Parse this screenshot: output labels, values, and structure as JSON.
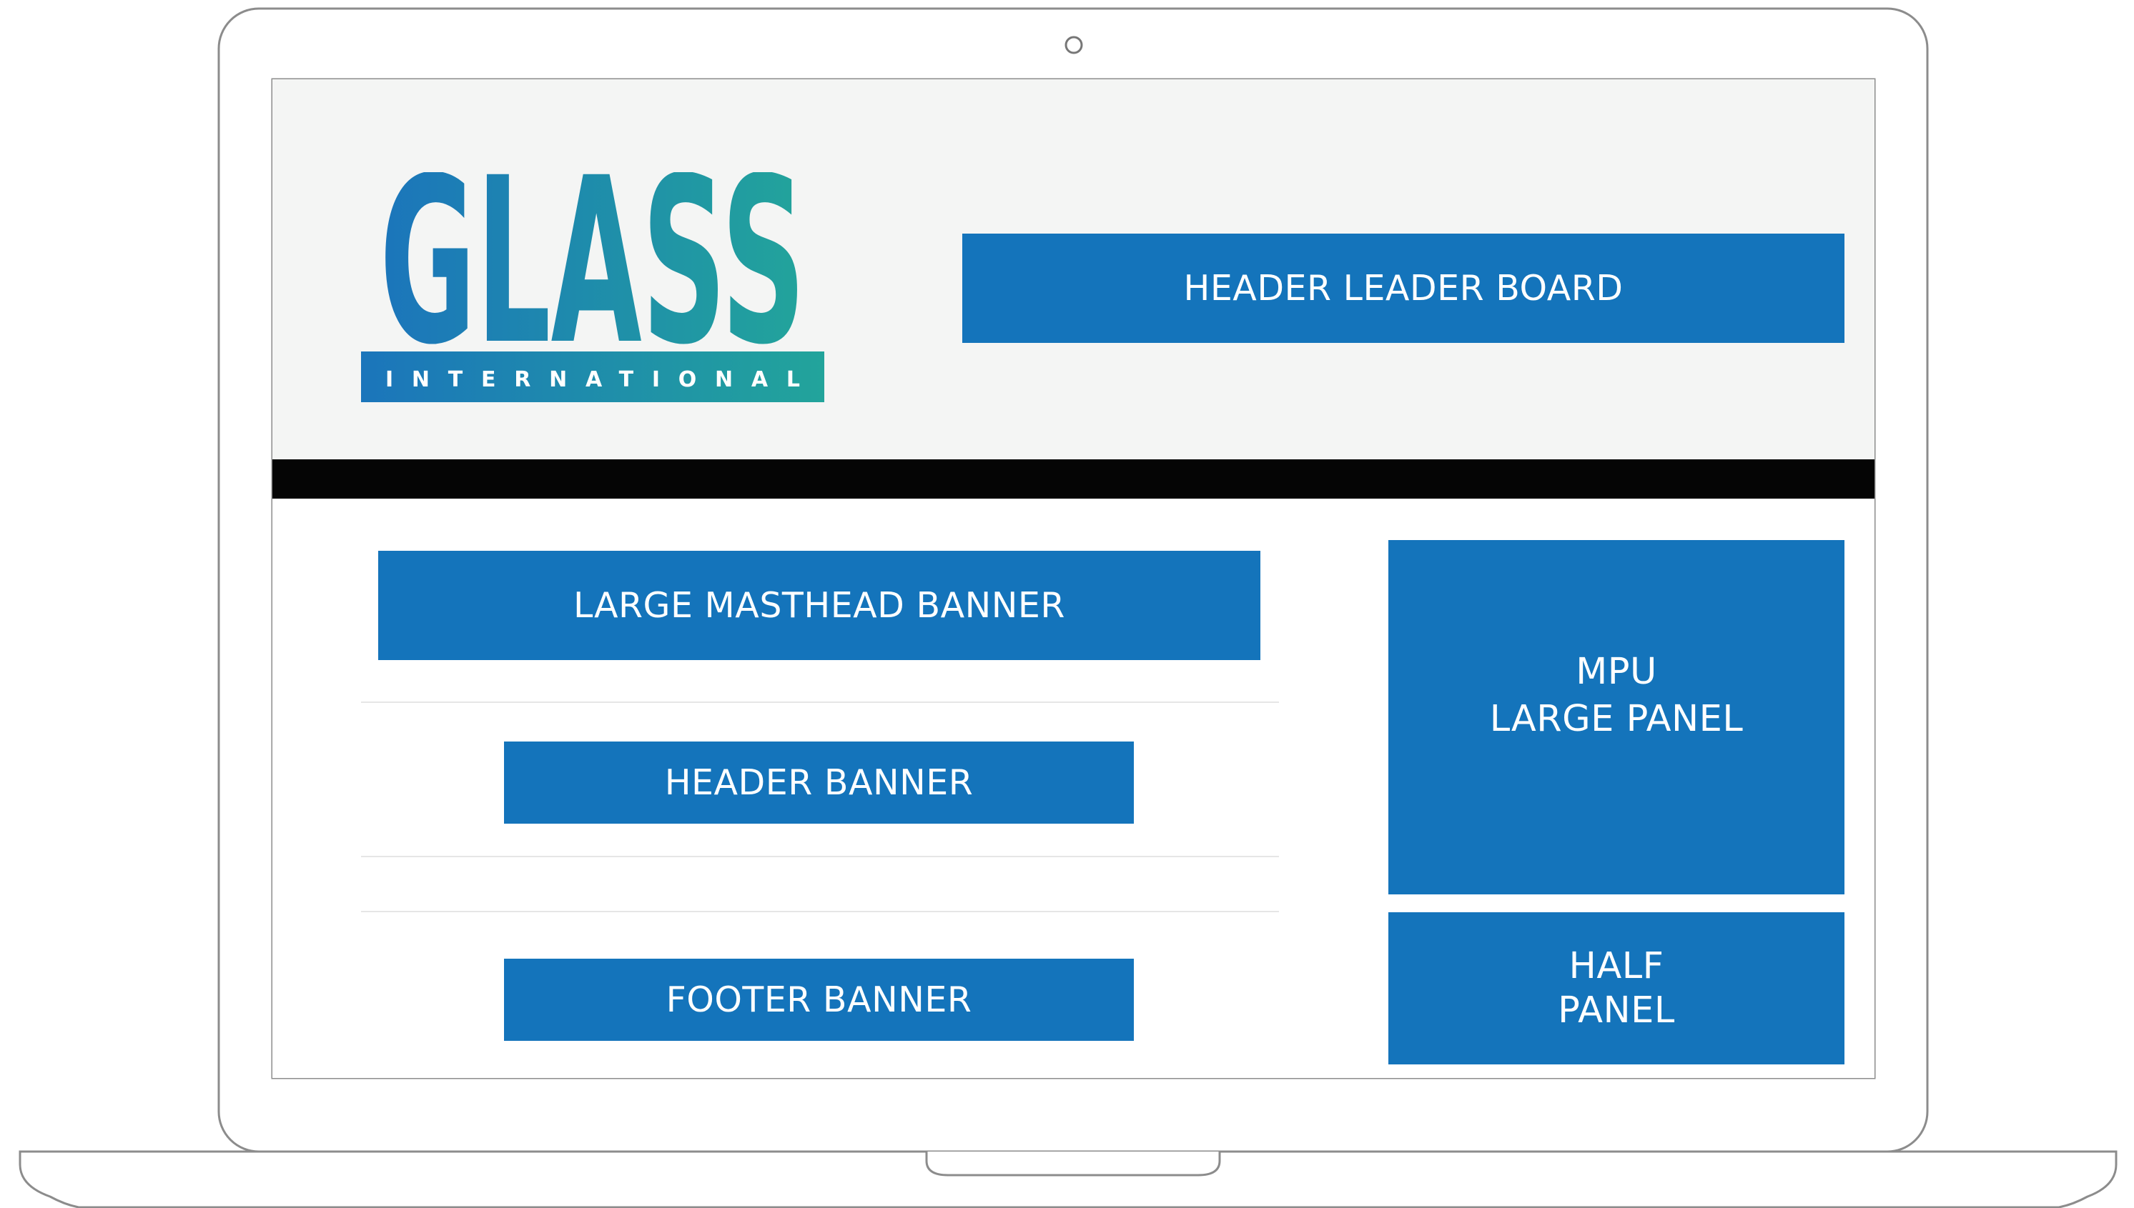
{
  "brand": {
    "logo_word": "GLASS",
    "logo_subtitle": "INTERNATIONAL",
    "gradient_start": "#1b75bb",
    "gradient_end": "#22a49b"
  },
  "ad_slots": {
    "header_leader_board": "HEADER LEADER BOARD",
    "large_masthead_banner": "LARGE MASTHEAD BANNER",
    "header_banner": "HEADER BANNER",
    "footer_banner": "FOOTER BANNER",
    "mpu_large_panel": {
      "line1": "MPU",
      "line2": "LARGE PANEL"
    },
    "half_panel": {
      "line1": "HALF",
      "line2": "PANEL"
    }
  },
  "colors": {
    "slot_blue": "#1474bb",
    "header_background": "#f4f5f4",
    "nav_bar": "#050505",
    "device_outline": "#8c8c8c"
  },
  "icons": {
    "camera": "webcam-icon",
    "laptop": "laptop-frame-icon"
  }
}
